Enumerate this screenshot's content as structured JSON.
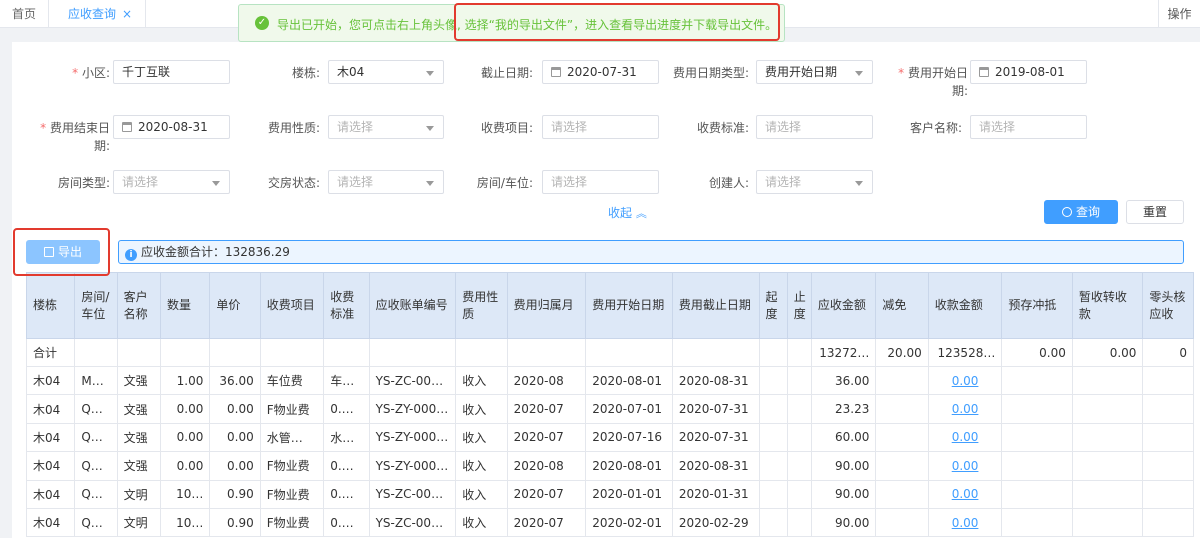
{
  "tabs": {
    "home": "首页",
    "active": "应收查询",
    "close": "×",
    "ops": "操作"
  },
  "notice": {
    "message": "导出已开始，您可点击右上角头像, 选择“我的导出文件”，进入查看导出进度并下载导出文件。"
  },
  "filters": {
    "community": {
      "label": "小区:",
      "value": "千丁互联"
    },
    "building": {
      "label": "楼栋:",
      "value": "木04"
    },
    "cutoff": {
      "label": "截止日期:",
      "value": "2020-07-31"
    },
    "fee_date_type": {
      "label": "费用日期类型:",
      "value": "费用开始日期"
    },
    "fee_start": {
      "label": "费用开始日期:",
      "value": "2019-08-01"
    },
    "fee_end": {
      "label": "费用结束日期:",
      "value": "2020-08-31"
    },
    "fee_nature": {
      "label": "费用性质:",
      "placeholder": "请选择"
    },
    "charge_item": {
      "label": "收费项目:",
      "placeholder": "请选择"
    },
    "charge_std": {
      "label": "收费标准:",
      "placeholder": "请选择"
    },
    "customer": {
      "label": "客户名称:",
      "placeholder": "请选择"
    },
    "room_type": {
      "label": "房间类型:",
      "placeholder": "请选择"
    },
    "handover": {
      "label": "交房状态:",
      "placeholder": "请选择"
    },
    "room_slot": {
      "label": "房间/车位:",
      "placeholder": "请选择"
    },
    "creator": {
      "label": "创建人:",
      "placeholder": "请选择"
    }
  },
  "actions": {
    "collapse": "收起",
    "query": "查询",
    "reset": "重置",
    "export": "导出"
  },
  "summary": {
    "label": "应收金额合计：132836.29"
  },
  "table": {
    "headers": [
      "楼栋",
      "房间/车位",
      "客户名称",
      "数量",
      "单价",
      "收费项目",
      "收费标准",
      "应收账单编号",
      "费用性质",
      "费用归属月",
      "费用开始日期",
      "费用截止日期",
      "起度",
      "止度",
      "应收金额",
      "减免",
      "收款金额",
      "预存冲抵",
      "暂收转收款",
      "零头核应收"
    ],
    "total": [
      "合计",
      "",
      "",
      "",
      "",
      "",
      "",
      "",
      "",
      "",
      "",
      "",
      "",
      "",
      "13272…",
      "20.00",
      "123528…",
      "0.00",
      "0.00",
      "0"
    ],
    "rows": [
      [
        "木04",
        "M…",
        "文强",
        "1.00",
        "36.00",
        "车位费",
        "车…",
        "YS-ZC-000…",
        "收入",
        "2020-08",
        "2020-08-01",
        "2020-08-31",
        "",
        "",
        "36.00",
        "",
        "0.00",
        "",
        "",
        ""
      ],
      [
        "木04",
        "Q…",
        "文强",
        "0.00",
        "0.00",
        "F物业费",
        "0.…",
        "YS-ZY-000…",
        "收入",
        "2020-07",
        "2020-07-01",
        "2020-07-31",
        "",
        "",
        "23.23",
        "",
        "0.00",
        "",
        "",
        ""
      ],
      [
        "木04",
        "Q…",
        "文强",
        "0.00",
        "0.00",
        "水管…",
        "水…",
        "YS-ZY-000…",
        "收入",
        "2020-07",
        "2020-07-16",
        "2020-07-31",
        "",
        "",
        "60.00",
        "",
        "0.00",
        "",
        "",
        ""
      ],
      [
        "木04",
        "Q…",
        "文强",
        "0.00",
        "0.00",
        "F物业费",
        "0.…",
        "YS-ZY-000…",
        "收入",
        "2020-08",
        "2020-08-01",
        "2020-08-31",
        "",
        "",
        "90.00",
        "",
        "0.00",
        "",
        "",
        ""
      ],
      [
        "木04",
        "Q…",
        "文明",
        "10…",
        "0.90",
        "F物业费",
        "0.…",
        "YS-ZC-000…",
        "收入",
        "2020-07",
        "2020-01-01",
        "2020-01-31",
        "",
        "",
        "90.00",
        "",
        "0.00",
        "",
        "",
        ""
      ],
      [
        "木04",
        "Q…",
        "文明",
        "10…",
        "0.90",
        "F物业费",
        "0.…",
        "YS-ZC-000…",
        "收入",
        "2020-07",
        "2020-02-01",
        "2020-02-29",
        "",
        "",
        "90.00",
        "",
        "0.00",
        "",
        "",
        ""
      ]
    ]
  }
}
